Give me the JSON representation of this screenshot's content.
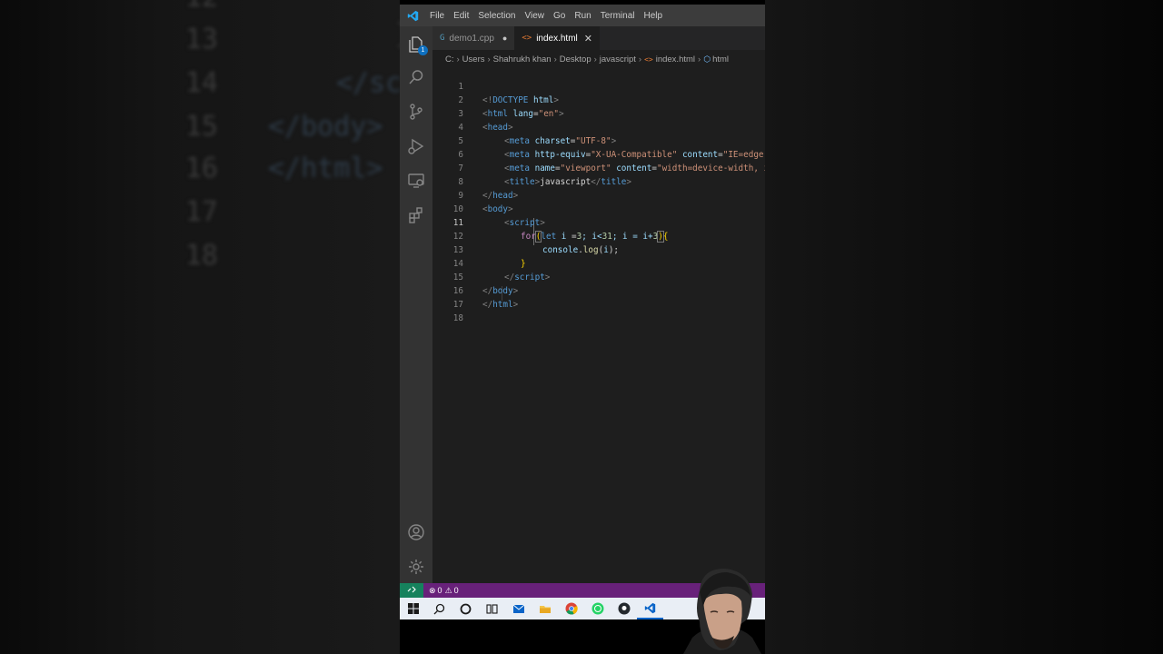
{
  "background": {
    "line_numbers": [
      "12",
      "13",
      "14",
      "15",
      "16",
      "17",
      "18"
    ],
    "code_lines": [
      "",
      "}",
      "</sc",
      "</body>",
      "</html>",
      "",
      ""
    ]
  },
  "menu": [
    "File",
    "Edit",
    "Selection",
    "View",
    "Go",
    "Run",
    "Terminal",
    "Help"
  ],
  "activity_badge": "1",
  "tabs": [
    {
      "label": "demo1.cpp",
      "state": "modified"
    },
    {
      "label": "index.html",
      "state": "active"
    }
  ],
  "breadcrumb": [
    "C:",
    "Users",
    "Shahrukh khan",
    "Desktop",
    "javascript",
    "index.html",
    "html"
  ],
  "editor": {
    "current_line": "11",
    "lines": [
      {
        "n": "1"
      },
      {
        "n": "2"
      },
      {
        "n": "3"
      },
      {
        "n": "4"
      },
      {
        "n": "5"
      },
      {
        "n": "6"
      },
      {
        "n": "7"
      },
      {
        "n": "8"
      },
      {
        "n": "9"
      },
      {
        "n": "10"
      },
      {
        "n": "11"
      },
      {
        "n": "12"
      },
      {
        "n": "13"
      },
      {
        "n": "14"
      },
      {
        "n": "15"
      },
      {
        "n": "16"
      },
      {
        "n": "17"
      },
      {
        "n": "18"
      }
    ],
    "tokens": {
      "l1": [
        "<!",
        "DOCTYPE",
        " html",
        ">"
      ],
      "l2": [
        "<",
        "html",
        " lang",
        "=",
        "\"en\"",
        ">"
      ],
      "l3": [
        "<",
        "head",
        ">"
      ],
      "l4": [
        "<",
        "meta",
        " charset",
        "=",
        "\"UTF-8\"",
        ">"
      ],
      "l5": [
        "<",
        "meta",
        " http-equiv",
        "=",
        "\"X-UA-Compatible\"",
        " content",
        "=",
        "\"IE=edge\"",
        ">"
      ],
      "l6": [
        "<",
        "meta",
        " name",
        "=",
        "\"viewport\"",
        " content",
        "=",
        "\"width=device-width, initial-scale=1.0\"",
        ">"
      ],
      "l7": [
        "<",
        "title",
        ">",
        "javascript",
        "</",
        "title",
        ">"
      ],
      "l8": [
        "</",
        "head",
        ">"
      ],
      "l9": [
        "<",
        "body",
        ">"
      ],
      "l10": [
        "<",
        "script",
        ">"
      ],
      "l11": [
        "for",
        "(",
        "let",
        " i ",
        "=",
        "3",
        "; i<",
        "31",
        "; i = i+",
        "3",
        ")",
        "{"
      ],
      "l12": [
        "console",
        ".",
        "log",
        "(",
        "i",
        ");"
      ],
      "l13": [
        "}"
      ],
      "l14": [
        "</",
        "script",
        ">"
      ],
      "l15": [
        "</",
        "body",
        ">"
      ],
      "l16": [
        "</",
        "html",
        ">"
      ]
    }
  },
  "status": {
    "errors": "0",
    "warnings": "0"
  },
  "colors": {
    "statusbar": "#68217a",
    "remote": "#16825d",
    "editor_bg": "#1e1e1e",
    "accent": "#0e70c0"
  }
}
